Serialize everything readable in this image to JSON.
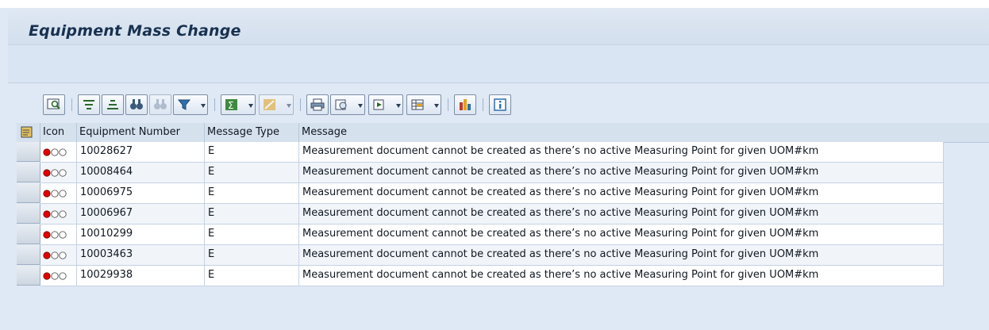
{
  "window": {
    "title": "Equipment Mass Change"
  },
  "toolbar": {
    "icons": [
      "details-icon",
      "sort-ascending-icon",
      "sort-descending-icon",
      "find-icon",
      "find-next-icon",
      "filter-icon",
      "total-icon",
      "subtotal-icon",
      "print-icon",
      "view-icon",
      "export-icon",
      "layout-icon",
      "graphic-icon",
      "information-icon"
    ]
  },
  "table": {
    "headers": {
      "icon": "Icon",
      "equipment": "Equipment Number",
      "type": "Message Type",
      "message": "Message"
    },
    "rows": [
      {
        "equipment": "10028627",
        "type": "E",
        "message": "Measurement document cannot be created as there’s no active Measuring Point for given UOM#km"
      },
      {
        "equipment": "10008464",
        "type": "E",
        "message": "Measurement document cannot be created as there’s no active Measuring Point for given UOM#km"
      },
      {
        "equipment": "10006975",
        "type": "E",
        "message": "Measurement document cannot be created as there’s no active Measuring Point for given UOM#km"
      },
      {
        "equipment": "10006967",
        "type": "E",
        "message": "Measurement document cannot be created as there’s no active Measuring Point for given UOM#km"
      },
      {
        "equipment": "10010299",
        "type": "E",
        "message": "Measurement document cannot be created as there’s no active Measuring Point for given UOM#km"
      },
      {
        "equipment": "10003463",
        "type": "E",
        "message": "Measurement document cannot be created as there’s no active Measuring Point for given UOM#km"
      },
      {
        "equipment": "10029938",
        "type": "E",
        "message": "Measurement document cannot be created as there’s no active Measuring Point for given UOM#km"
      }
    ],
    "status_icon": "error-traffic-light-icon"
  },
  "colors": {
    "error": "#e00000",
    "accent": "#e6a11a",
    "title": "#18314f"
  }
}
